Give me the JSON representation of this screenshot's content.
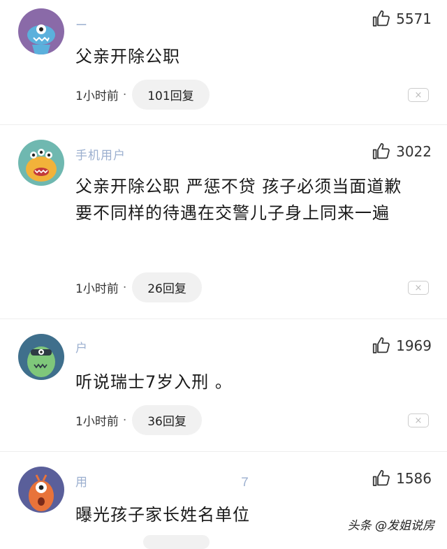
{
  "comments": [
    {
      "username": "ー　",
      "like_icon": "thumbs-up-icon",
      "likes": "5571",
      "content": "父亲开除公职",
      "time": "1小时前",
      "separator": "·",
      "replies": "101回复",
      "dismiss": "×"
    },
    {
      "username": "手机用户",
      "like_icon": "thumbs-up-icon",
      "likes": "3022",
      "content": "父亲开除公职 严惩不贷 孩子必须当面道歉 要不同样的待遇在交警儿子身上同来一遍",
      "time": "1小时前",
      "separator": "·",
      "replies": "26回复",
      "dismiss": "×"
    },
    {
      "username": "户　",
      "like_icon": "thumbs-up-icon",
      "likes": "1969",
      "content": "听说瑞士7岁入刑 。",
      "time": "1小时前",
      "separator": "·",
      "replies": "36回复",
      "dismiss": "×"
    },
    {
      "username": "用　　　　　　　　　　　　７",
      "like_icon": "thumbs-up-icon",
      "likes": "1586",
      "content": "曝光孩子家长姓名单位"
    }
  ],
  "watermark": "头条 @发姐说房",
  "colors": {
    "username": "#4a6ea9",
    "reply_bg": "#f1f1f1",
    "text": "#1a1a1a"
  }
}
